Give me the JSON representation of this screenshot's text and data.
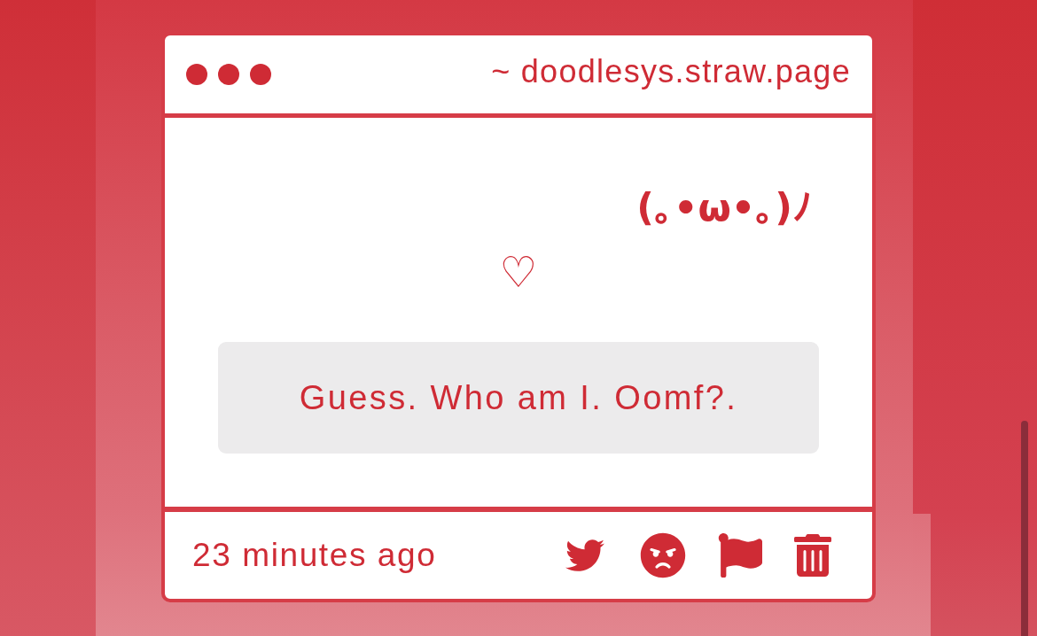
{
  "window": {
    "url": "~ doodlesys.straw.page"
  },
  "post": {
    "kaomoji": "(｡•ω•｡)ﾉ",
    "like": "♡",
    "message": "Guess. Who am I. Oomf?."
  },
  "footer": {
    "time": "23 minutes ago"
  }
}
